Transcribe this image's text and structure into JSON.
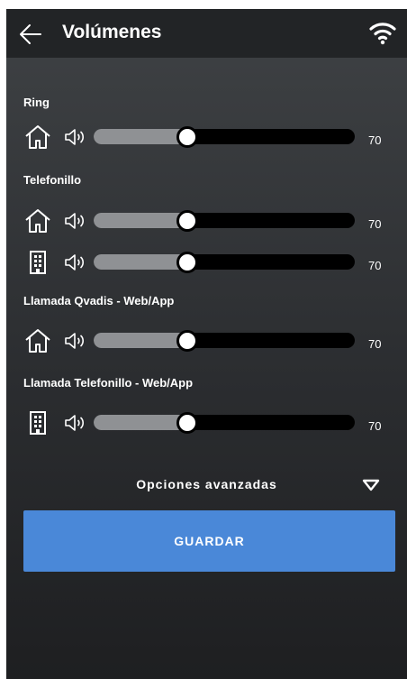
{
  "header": {
    "title": "Volúmenes",
    "back_icon": "arrow-left-icon",
    "status_icon": "wifi-icon"
  },
  "sections": [
    {
      "label": "Ring",
      "rows": [
        {
          "device": "house-icon",
          "level": 0.36,
          "value": "70"
        }
      ]
    },
    {
      "label": "Telefonillo",
      "rows": [
        {
          "device": "house-icon",
          "level": 0.36,
          "value": "70"
        },
        {
          "device": "building-icon",
          "level": 0.36,
          "value": "70"
        }
      ]
    },
    {
      "label": "Llamada Qvadis - Web/App",
      "rows": [
        {
          "device": "house-icon",
          "level": 0.36,
          "value": "70"
        }
      ]
    },
    {
      "label": "Llamada Telefonillo - Web/App",
      "rows": [
        {
          "device": "building-icon",
          "level": 0.36,
          "value": "70"
        }
      ]
    }
  ],
  "advanced": {
    "label": "Opciones avanzadas",
    "icon": "caret-down-icon"
  },
  "save_button": {
    "label": "GUARDAR"
  },
  "colors": {
    "accent": "#4a88d8",
    "track": "#000000",
    "fill": "#8f9194",
    "topbar": "#222426"
  }
}
